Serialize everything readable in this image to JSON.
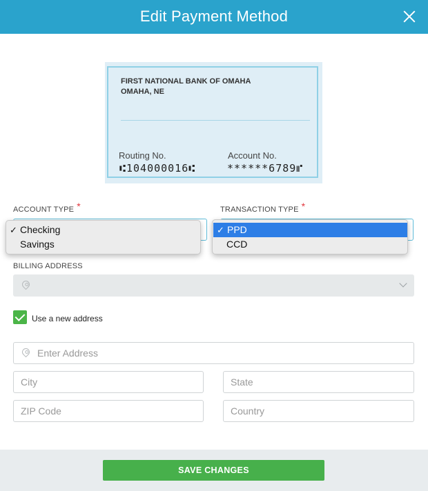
{
  "header": {
    "title": "Edit Payment Method"
  },
  "check": {
    "bank_name": "FIRST NATIONAL BANK OF OMAHA",
    "bank_city": "OMAHA, NE",
    "routing_label": "Routing No.",
    "routing_number": "⑆104000016⑆",
    "account_label": "Account No.",
    "account_number": "******6789⑈"
  },
  "account_type": {
    "label": "ACCOUNT TYPE",
    "required_marker": "*",
    "options": [
      "Checking",
      "Savings"
    ],
    "checkmark": "✓"
  },
  "transaction_type": {
    "label": "TRANSACTION TYPE",
    "required_marker": "*",
    "options": [
      "PPD",
      "CCD"
    ],
    "checkmark": "✓"
  },
  "billing_address": {
    "label": "BILLING ADDRESS"
  },
  "use_new_address": {
    "label": "Use a new address",
    "checked": true
  },
  "address_fields": {
    "address_placeholder": "Enter Address",
    "city_placeholder": "City",
    "state_placeholder": "State",
    "zip_placeholder": "ZIP Code",
    "country_placeholder": "Country"
  },
  "footer": {
    "save_label": "SAVE CHANGES"
  },
  "colors": {
    "header": "#2aa3cc",
    "save": "#47b04b",
    "checkbox": "#4bb548",
    "selected_option": "#2d7ee6",
    "required": "#e2383f"
  }
}
